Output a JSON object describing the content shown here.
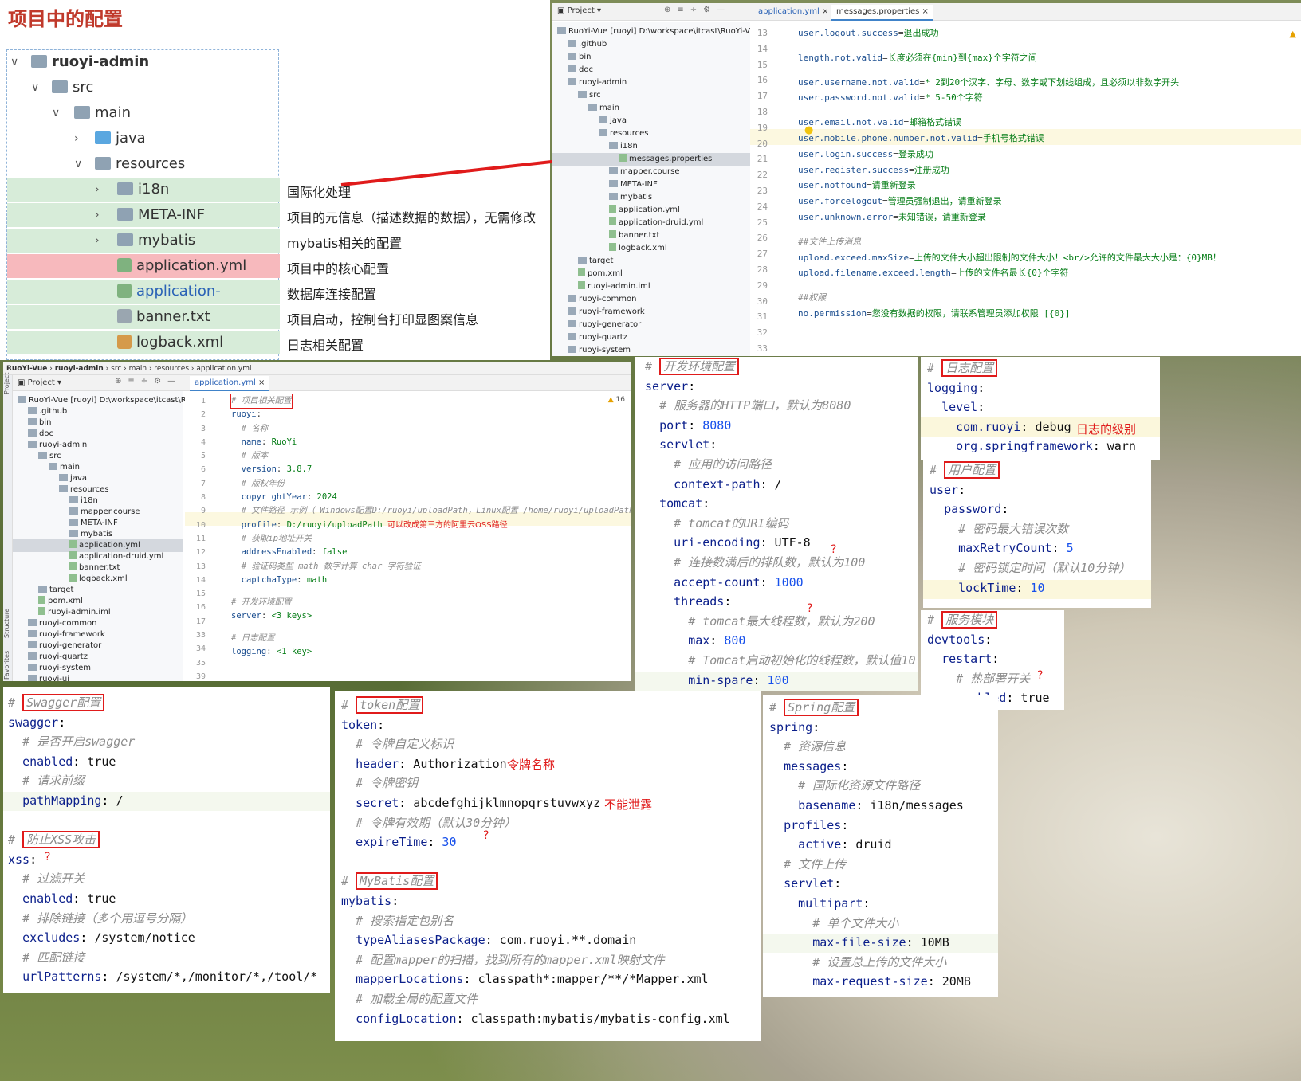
{
  "title": "项目中的配置",
  "tree": {
    "root": "ruoyi-admin",
    "src": "src",
    "main": "main",
    "java": "java",
    "resources": "resources",
    "items": [
      {
        "label": "i18n",
        "desc": "国际化处理",
        "kind": "folder"
      },
      {
        "label": "META-INF",
        "desc": "项目的元信息（描述数据的数据），无需修改",
        "kind": "folder"
      },
      {
        "label": "mybatis",
        "desc": "mybatis相关的配置",
        "kind": "folder"
      },
      {
        "label": "application.yml",
        "desc": "项目中的核心配置",
        "kind": "file"
      },
      {
        "label": "application-druid.yml",
        "desc": "数据库连接配置",
        "kind": "file"
      },
      {
        "label": "banner.txt",
        "desc": "项目启动，控制台打印显图案信息",
        "kind": "file"
      },
      {
        "label": "logback.xml",
        "desc": "日志相关配置",
        "kind": "file"
      }
    ]
  },
  "ide1": {
    "project_label": "Project",
    "tab1": "application.yml",
    "tab2": "messages.properties",
    "tree": [
      "RuoYi-Vue [ruoyi]  D:\\workspace\\itcast\\RuoYi-Vue",
      ".github",
      "bin",
      "doc",
      "ruoyi-admin",
      "src",
      "main",
      "java",
      "resources",
      "i18n",
      "messages.properties",
      "mapper.course",
      "META-INF",
      "mybatis",
      "application.yml",
      "application-druid.yml",
      "banner.txt",
      "logback.xml",
      "target",
      "pom.xml",
      "ruoyi-admin.iml",
      "ruoyi-common",
      "ruoyi-framework",
      "ruoyi-generator",
      "ruoyi-quartz",
      "ruoyi-system"
    ],
    "lines": [
      "13",
      "14",
      "15",
      "16",
      "17",
      "18",
      "19",
      "20",
      "21",
      "22",
      "23",
      "24",
      "25",
      "26",
      "27",
      "28",
      "29",
      "30",
      "31",
      "32",
      "33"
    ],
    "code": [
      "user.logout.success=退出成功",
      "",
      "length.not.valid=长度必须在{min}到{max}个字符之间",
      "",
      "user.username.not.valid=* 2到20个汉字、字母、数字或下划线组成，且必须以非数字开头",
      "user.password.not.valid=* 5-50个字符",
      "",
      "user.email.not.valid=邮箱格式错误",
      "user.mobile.phone.number.not.valid=手机号格式错误",
      "user.login.success=登录成功",
      "user.register.success=注册成功",
      "user.notfound=请重新登录",
      "user.forcelogout=管理员强制退出，请重新登录",
      "user.unknown.error=未知错误，请重新登录",
      "",
      "##文件上传消息",
      "upload.exceed.maxSize=上传的文件大小超出限制的文件大小！<br/>允许的文件最大大小是：{0}MB！",
      "upload.filename.exceed.length=上传的文件名最长{0}个字符",
      "",
      "##权限",
      "no.permission=您没有数据的权限，请联系管理员添加权限 [{0}]"
    ]
  },
  "ide2": {
    "breadcrumb": [
      "RuoYi-Vue",
      "ruoyi-admin",
      "src",
      "main",
      "resources",
      "application.yml"
    ],
    "project_label": "Project",
    "tab": "application.yml",
    "warn": "16",
    "tree": [
      "RuoYi-Vue [ruoyi]  D:\\workspace\\itcast\\RuoYi-Vue",
      ".github",
      "bin",
      "doc",
      "ruoyi-admin",
      "src",
      "main",
      "java",
      "resources",
      "i18n",
      "mapper.course",
      "META-INF",
      "mybatis",
      "application.yml",
      "application-druid.yml",
      "banner.txt",
      "logback.xml",
      "target",
      "pom.xml",
      "ruoyi-admin.iml",
      "ruoyi-common",
      "ruoyi-framework",
      "ruoyi-generator",
      "ruoyi-quartz",
      "ruoyi-system",
      "ruoyi-ui"
    ],
    "lines": [
      "1",
      "2",
      "3",
      "4",
      "5",
      "6",
      "7",
      "8",
      "9",
      "10",
      "11",
      "12",
      "13",
      "14",
      "15",
      "16",
      "17",
      "33",
      "34",
      "35",
      "39"
    ],
    "code": [
      "# 项目相关配置",
      "ruoyi:",
      "  # 名称",
      "  name: RuoYi",
      "  # 版本",
      "  version: 3.8.7",
      "  # 版权年份",
      "  copyrightYear: 2024",
      "  # 文件路径 示例（ Windows配置D:/ruoyi/uploadPath，Linux配置 /home/ruoyi/uploadPath）",
      "  profile: D:/ruoyi/uploadPath",
      "  # 获取ip地址开关",
      "  addressEnabled: false",
      "  # 验证码类型 math 数字计算 char 字符验证",
      "  captchaType: math",
      "",
      "# 开发环境配置",
      "server: <3 keys>",
      "",
      "# 日志配置",
      "logging: <1 key>",
      ""
    ],
    "profile_note": "可以改成第三方的阿里云OSS路径",
    "side_labels": [
      "Project",
      "Structure",
      "Favorites"
    ]
  },
  "server_panel": {
    "header": "开发环境配置",
    "lines": [
      "server:",
      "  # 服务器的HTTP端口，默认为8080",
      "  port: 8080",
      "  servlet:",
      "    # 应用的访问路径",
      "    context-path: /",
      "  tomcat:",
      "    # tomcat的URI编码",
      "    uri-encoding: UTF-8",
      "    # 连接数满后的排队数，默认为100",
      "    accept-count: 1000",
      "    threads:",
      "      # tomcat最大线程数，默认为200",
      "      max: 800",
      "      # Tomcat启动初始化的线程数，默认值10",
      "      min-spare: 100"
    ],
    "q": "?"
  },
  "logging_panel": {
    "header": "日志配置",
    "lines": [
      "logging:",
      "  level:",
      "    com.ruoyi: debug",
      "    org.springframework: warn"
    ],
    "note": "日志的级别"
  },
  "user_panel": {
    "header": "用户配置",
    "lines": [
      "user:",
      "  password:",
      "    # 密码最大错误次数",
      "    maxRetryCount: 5",
      "    # 密码锁定时间（默认10分钟）",
      "    lockTime: 10"
    ]
  },
  "devtools_panel": {
    "header": "服务模块",
    "lines": [
      "devtools:",
      "  restart:",
      "    # 热部署开关",
      "    enabled: true"
    ],
    "q": "?"
  },
  "swagger_panel": {
    "header": "Swagger配置",
    "lines": [
      "swagger:",
      "  # 是否开启swagger",
      "  enabled: true",
      "  # 请求前缀",
      "  pathMapping: /"
    ],
    "xss_header": "防止XSS攻击",
    "xss_lines": [
      "xss:",
      "  # 过滤开关",
      "  enabled: true",
      "  # 排除链接（多个用逗号分隔）",
      "  excludes: /system/notice",
      "  # 匹配链接",
      "  urlPatterns: /system/*,/monitor/*,/tool/*"
    ],
    "q": "?"
  },
  "token_panel": {
    "header": "token配置",
    "lines": [
      "token:",
      "  # 令牌自定义标识",
      "  header: Authorization",
      "  # 令牌密钥",
      "  secret: abcdefghijklmnopqrstuvwxyz",
      "  # 令牌有效期（默认30分钟）",
      "  expireTime: 30"
    ],
    "note_header": "令牌名称",
    "note_secret": "不能泄露",
    "q": "?",
    "mybatis_header": "MyBatis配置",
    "mybatis_lines": [
      "mybatis:",
      "  # 搜索指定包别名",
      "  typeAliasesPackage: com.ruoyi.**.domain",
      "  # 配置mapper的扫描，找到所有的mapper.xml映射文件",
      "  mapperLocations: classpath*:mapper/**/*Mapper.xml",
      "  # 加载全局的配置文件",
      "  configLocation: classpath:mybatis/mybatis-config.xml"
    ]
  },
  "spring_panel": {
    "header": "Spring配置",
    "lines": [
      "spring:",
      "  # 资源信息",
      "  messages:",
      "    # 国际化资源文件路径",
      "    basename: i18n/messages",
      "  profiles:",
      "    active: druid",
      "  # 文件上传",
      "  servlet:",
      "    multipart:",
      "      # 单个文件大小",
      "      max-file-size: 10MB",
      "      # 设置总上传的文件大小",
      "      max-request-size: 20MB"
    ]
  },
  "colors": {
    "accent_red": "#e01b1b",
    "green_row": "#d7ecd9",
    "red_row": "#f7b9bd"
  }
}
